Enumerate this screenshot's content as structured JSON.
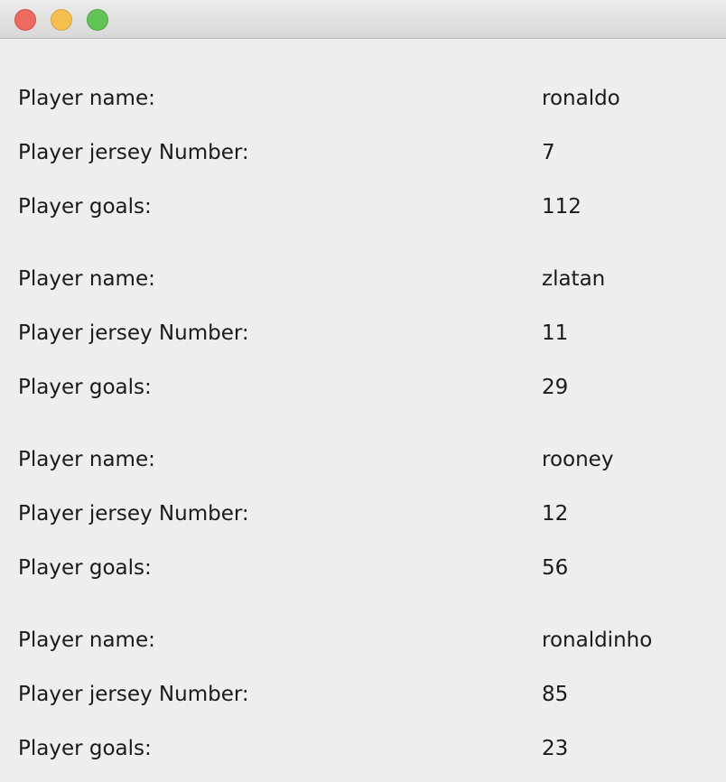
{
  "window": {
    "buttons": [
      "close",
      "minimize",
      "maximize"
    ]
  },
  "players": [
    {
      "name_label": "Player name:",
      "name": "ronaldo",
      "jersey_label": "Player jersey Number:",
      "jersey": "7",
      "goals_label": "Player goals:",
      "goals": "112"
    },
    {
      "name_label": "Player name:",
      "name": "zlatan",
      "jersey_label": "Player jersey Number:",
      "jersey": "11",
      "goals_label": "Player goals:",
      "goals": "29"
    },
    {
      "name_label": "Player name:",
      "name": "rooney",
      "jersey_label": "Player jersey Number:",
      "jersey": "12",
      "goals_label": "Player goals:",
      "goals": "56"
    },
    {
      "name_label": "Player name:",
      "name": "ronaldinho",
      "jersey_label": "Player jersey Number:",
      "jersey": "85",
      "goals_label": "Player goals:",
      "goals": "23"
    }
  ]
}
